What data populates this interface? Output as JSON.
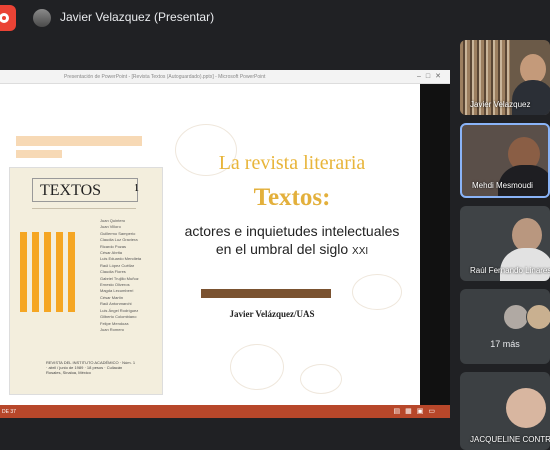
{
  "meeting": {
    "presenter_label": "Javier Velazquez (Presentar)"
  },
  "window": {
    "title": "Presentación de PowerPoint - [Revista Textos (Autoguardado).pptx] - Microsoft PowerPoint",
    "status_left": "DE 37"
  },
  "slide": {
    "cover": {
      "title": "TEXTOS",
      "number": "1",
      "names": [
        "Juan Quintero",
        "Juan Villoro",
        "Guillermo Samperio",
        "Claudia Luz Graviera",
        "Ricardo Pozas",
        "César Abrita",
        "Luis Eduardo Mendieta",
        "Raúl López Cuéllar",
        "Claudia Flores",
        "Gabriel Trujillo Muñoz",
        "Ernesto Oliveros",
        "Magda Lecumberri",
        "César Martín",
        "Raúl Antonmarchi",
        "Luis Ángel Rodríguez",
        "Gilberto Colombiano",
        "Felipe Mendoza",
        "Juan Romero"
      ],
      "footer": "REVISTA DEL INSTITUTO ACADÉMICO · Núm. 1 · abril / junio de 1989 · 18 pesos · Culiacán Rosales, Sinaloa, México"
    },
    "heading_1": "La revista literaria",
    "heading_2": "Textos:",
    "heading_3a": "actores e inquietudes intelectuales",
    "heading_3b": "en el umbral del siglo",
    "heading_3_century": "XXI",
    "author": "Javier Velázquez/UAS"
  },
  "participants": [
    {
      "name": "Javier Velazquez"
    },
    {
      "name": "Mehdi Mesmoudi"
    },
    {
      "name": "Raúl Fernando Linares"
    },
    {
      "more_label": "17 más"
    },
    {
      "name": "JACQUELINE CONTRERAS"
    }
  ],
  "colors": {
    "record": "#ea4335",
    "accent_gold": "#e3b03c",
    "status_bar": "#b7472a",
    "active_speaker_border": "#8ab4f8"
  }
}
